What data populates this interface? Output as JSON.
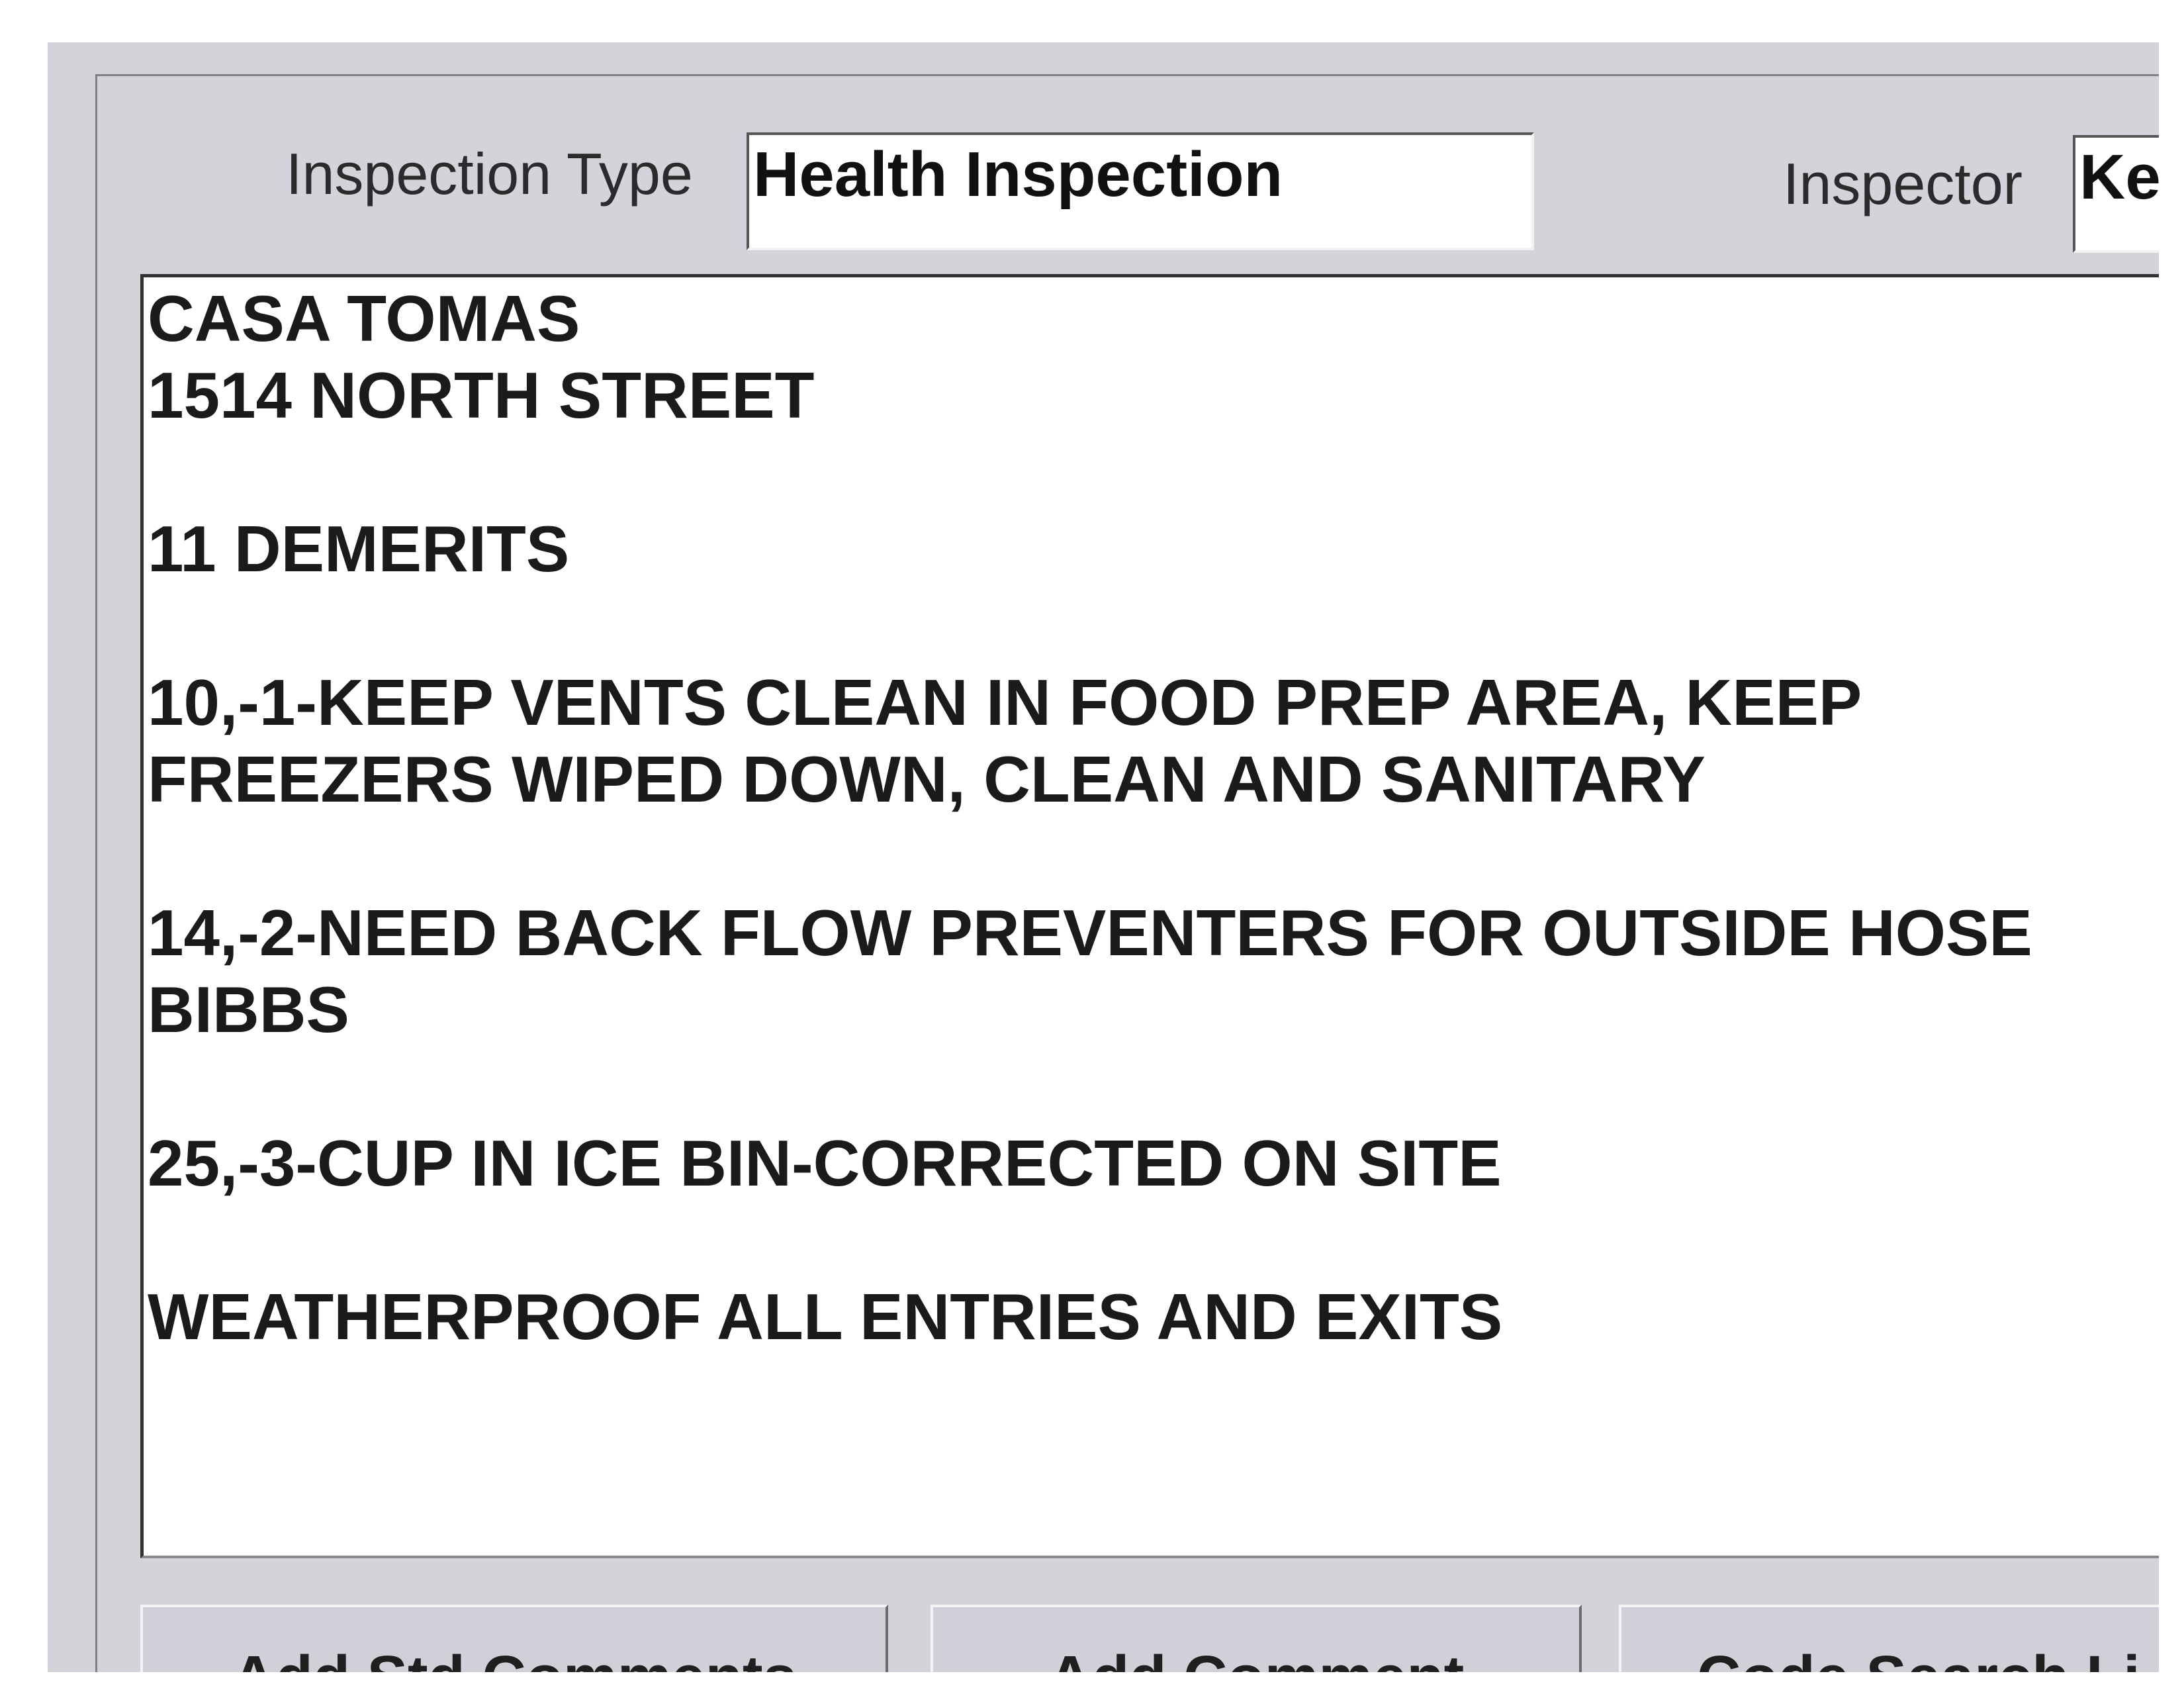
{
  "header": {
    "inspection_type_label": "Inspection Type",
    "inspection_type_value": "Health Inspection",
    "inspector_label": "Inspector",
    "inspector_value": "Ke"
  },
  "comments": {
    "lines": [
      "CASA TOMAS",
      "1514 NORTH STREET",
      "",
      "11 DEMERITS",
      "",
      "10,-1-KEEP VENTS CLEAN IN FOOD PREP AREA, KEEP",
      "FREEZERS WIPED DOWN, CLEAN AND SANITARY",
      "",
      "14,-2-NEED BACK FLOW PREVENTERS FOR OUTSIDE HOSE",
      "BIBBS",
      "",
      "25,-3-CUP IN ICE BIN-CORRECTED ON SITE",
      "",
      "WEATHERPROOF ALL ENTRIES AND EXITS"
    ]
  },
  "buttons": {
    "add_std_comments": {
      "before": "Add ",
      "accel": "S",
      "after": "td Comments"
    },
    "add_comment": {
      "before": "",
      "accel": "A",
      "after": "dd Comment"
    },
    "code_search": {
      "label": "Code Search Li"
    }
  },
  "colors": {
    "panel": "#d3d4da",
    "field_bg": "#ffffff",
    "text": "#1b1b1b"
  }
}
